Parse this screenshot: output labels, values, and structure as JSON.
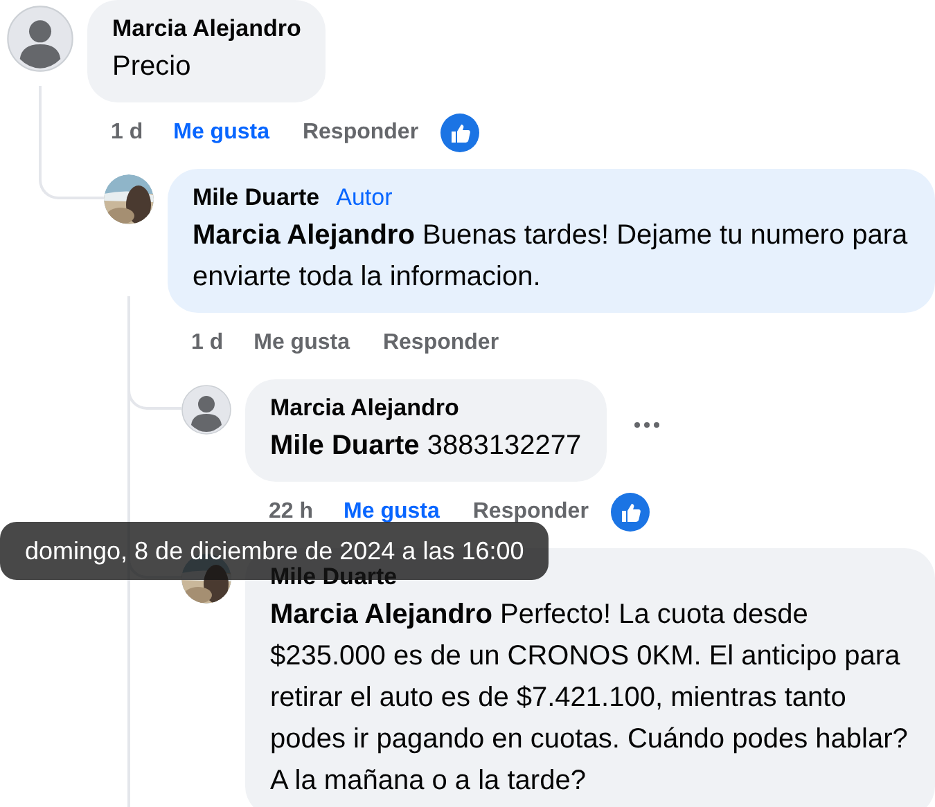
{
  "comments": [
    {
      "author": "Marcia Alejandro",
      "avatar": {
        "kind": "default"
      },
      "color": "#f0f2f5",
      "text": "Precio",
      "actions": {
        "time": "1 d",
        "like": "Me gusta",
        "liked": true,
        "reply": "Responder",
        "reaction": true
      },
      "children": [
        {
          "author": "Mile Duarte",
          "badge": "Autor",
          "color": "#e7f1fd",
          "mention": "Marcia Alejandro",
          "text": "Buenas tardes! Dejame tu numero para enviarte toda la informacion.",
          "actions": {
            "time": "1 d",
            "like": "Me gusta",
            "liked": false,
            "reply": "Responder",
            "reaction": false
          },
          "children": [
            {
              "author": "Marcia Alejandro",
              "avatar": {
                "kind": "default"
              },
              "color": "#f0f2f5",
              "mention": "Mile Duarte",
              "text": "3883132277",
              "more_button": true,
              "actions": {
                "time": "22 h",
                "like": "Me gusta",
                "liked": true,
                "reply": "Responder",
                "reaction": true
              }
            },
            {
              "author": "Mile Duarte",
              "color": "#f0f2f5",
              "mention": "Marcia Alejandro",
              "text": "Perfecto! La cuota desde $235.000 es de un CRONOS 0KM. El anticipo para retirar el auto es de $7.421.100, mientras tanto podes ir pagando en cuotas. Cuándo podes hablar? A la mañana o a la tarde?"
            }
          ]
        }
      ]
    }
  ],
  "tooltip": "domingo, 8 de diciembre de 2024 a las 16:00"
}
